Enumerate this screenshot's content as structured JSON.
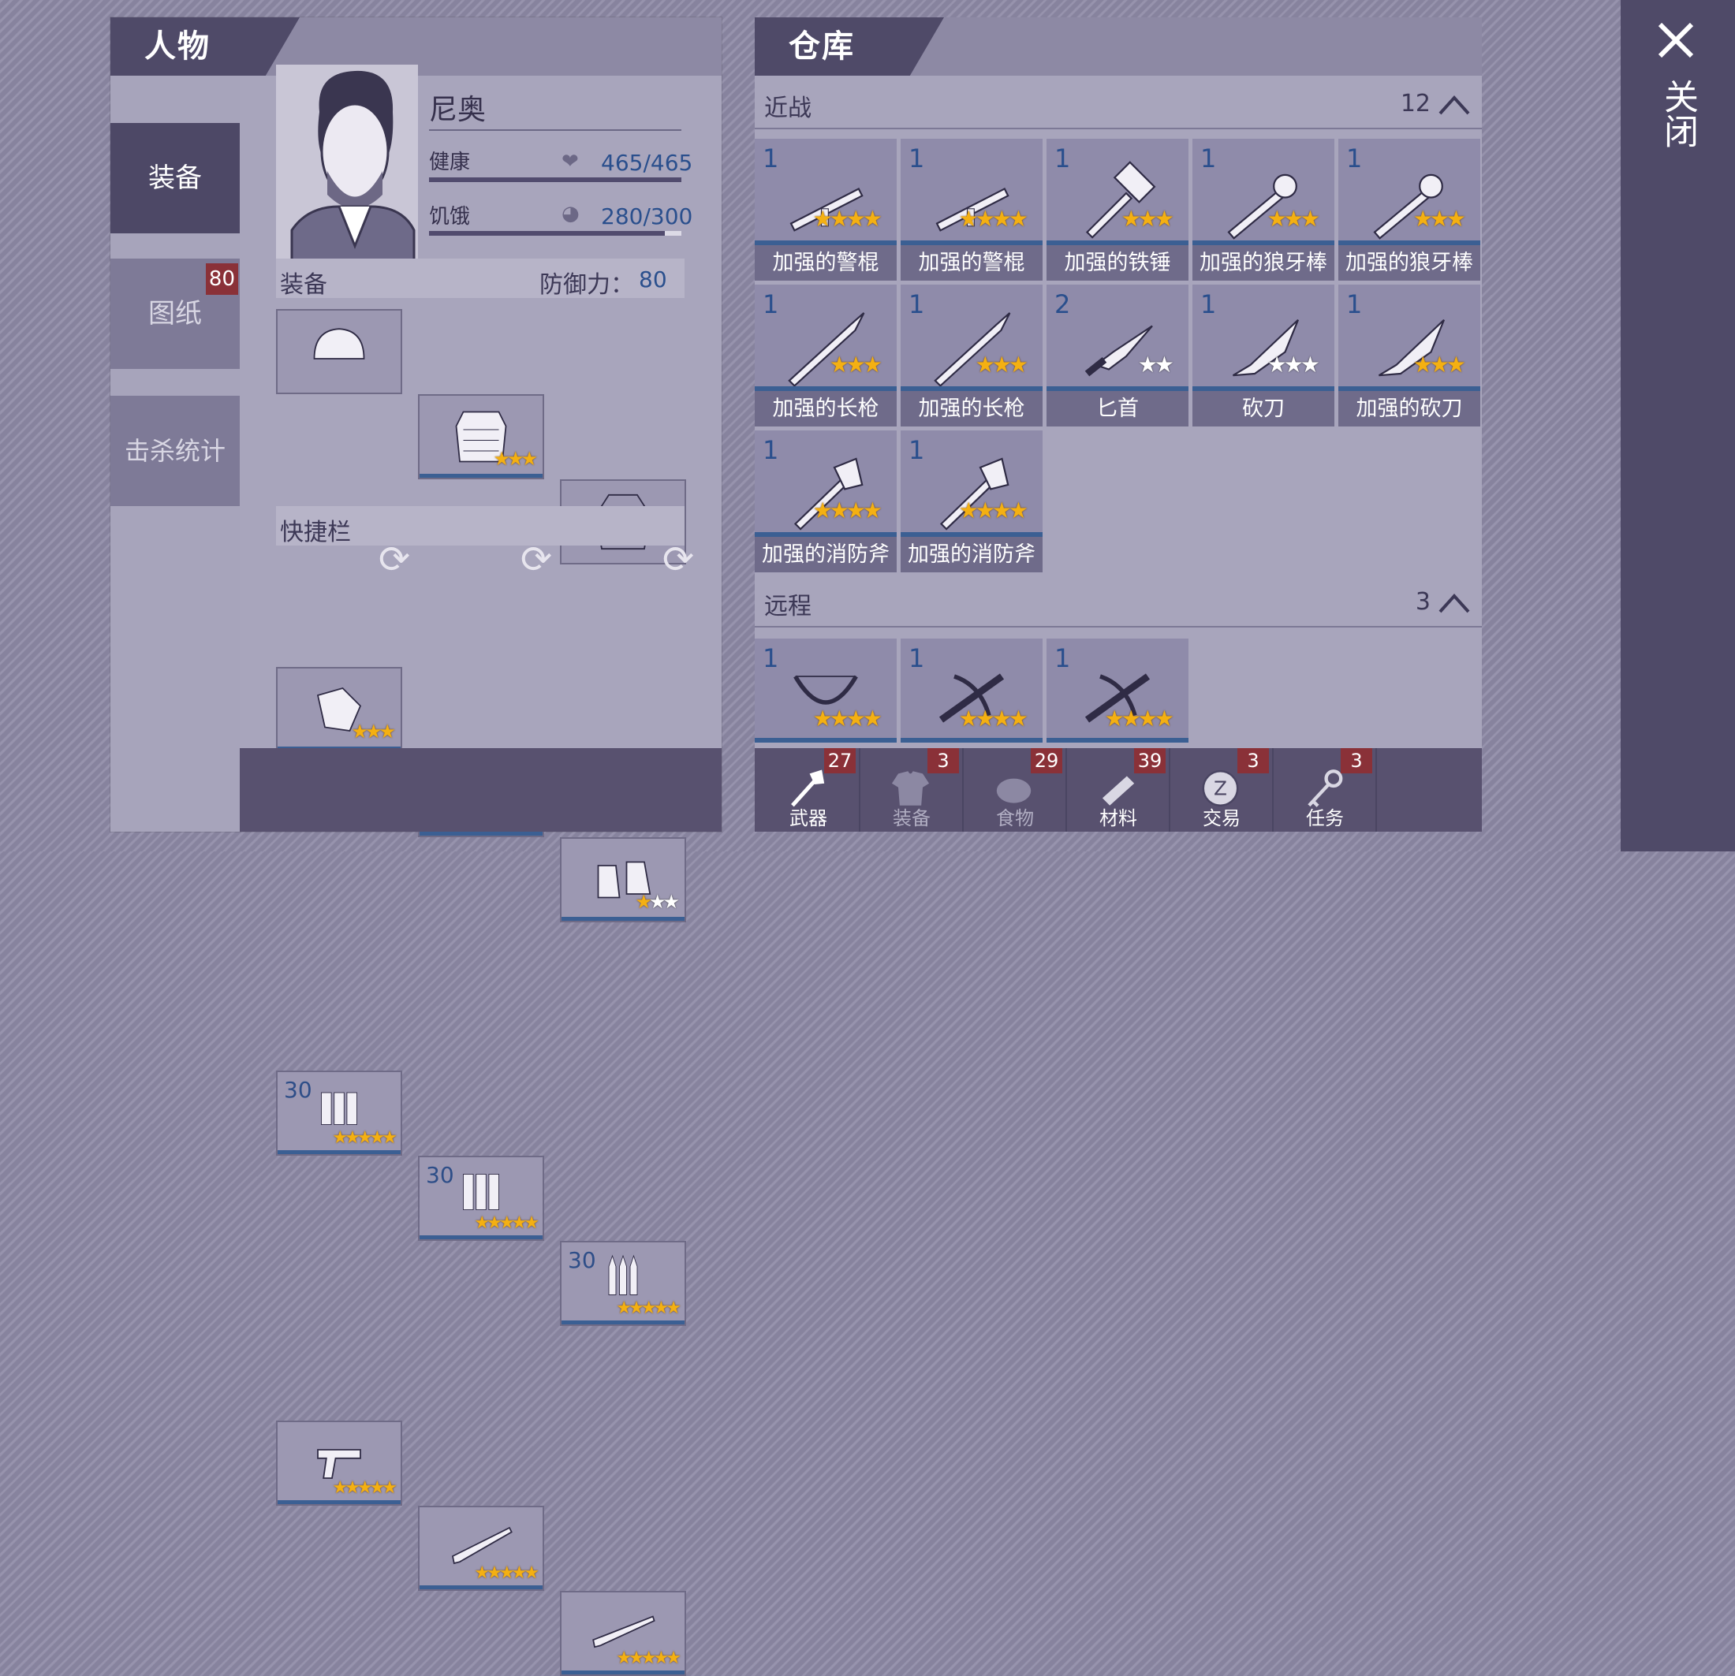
{
  "close": {
    "label": "关闭"
  },
  "left": {
    "title": "人物",
    "side_tabs": [
      {
        "label": "装备"
      },
      {
        "label": "图纸",
        "badge": "80"
      },
      {
        "label": "击杀统计"
      }
    ],
    "character": {
      "name": "尼奥",
      "health_label": "健康",
      "health_value": "465/465",
      "health_fraction": 1.0,
      "hunger_label": "饥饿",
      "hunger_value": "280/300",
      "hunger_fraction": 0.933
    },
    "equipment": {
      "label": "装备",
      "defense_label": "防御力：",
      "defense_value": "80",
      "slots": [
        {
          "icon": "helmet-icon",
          "stars": 0,
          "max_stars": 0
        },
        {
          "icon": "armor-vest-icon",
          "stars": 3,
          "max_stars": 3
        },
        {
          "icon": "jacket-icon",
          "stars": 0,
          "max_stars": 0
        },
        {
          "icon": "gloves-icon",
          "stars": 3,
          "max_stars": 3
        },
        {
          "icon": "pants-icon",
          "stars": 1,
          "max_stars": 3
        },
        {
          "icon": "boots-icon",
          "stars": 1,
          "max_stars": 3
        }
      ]
    },
    "quickbar": {
      "label": "快捷栏",
      "slots": [
        {
          "icon": "pistol-ammo-icon",
          "qty": "30",
          "stars": 5
        },
        {
          "icon": "shotgun-ammo-icon",
          "qty": "30",
          "stars": 5
        },
        {
          "icon": "rifle-ammo-icon",
          "qty": "30",
          "stars": 5
        },
        {
          "icon": "revolver-icon",
          "stars": 5
        },
        {
          "icon": "shotgun-icon",
          "stars": 5
        },
        {
          "icon": "rifle-icon",
          "stars": 5
        }
      ]
    }
  },
  "right": {
    "title": "仓库",
    "melee": {
      "label": "近战",
      "count": "12",
      "items": [
        {
          "name": "加强的警棍",
          "qty": "1",
          "stars": 4,
          "max_stars": 4,
          "icon": "baton-icon"
        },
        {
          "name": "加强的警棍",
          "qty": "1",
          "stars": 4,
          "max_stars": 4,
          "icon": "baton-icon"
        },
        {
          "name": "加强的铁锤",
          "qty": "1",
          "stars": 3,
          "max_stars": 3,
          "icon": "hammer-icon"
        },
        {
          "name": "加强的狼牙棒",
          "qty": "1",
          "stars": 3,
          "max_stars": 3,
          "icon": "mace-icon"
        },
        {
          "name": "加强的狼牙棒",
          "qty": "1",
          "stars": 3,
          "max_stars": 3,
          "icon": "mace-icon"
        },
        {
          "name": "加强的长枪",
          "qty": "1",
          "stars": 3,
          "max_stars": 3,
          "icon": "spear-icon"
        },
        {
          "name": "加强的长枪",
          "qty": "1",
          "stars": 3,
          "max_stars": 3,
          "icon": "spear-icon"
        },
        {
          "name": "匕首",
          "qty": "2",
          "stars": 0,
          "max_stars": 2,
          "icon": "dagger-icon"
        },
        {
          "name": "砍刀",
          "qty": "1",
          "stars": 0,
          "max_stars": 3,
          "icon": "machete-icon"
        },
        {
          "name": "加强的砍刀",
          "qty": "1",
          "stars": 3,
          "max_stars": 3,
          "icon": "machete-icon"
        },
        {
          "name": "加强的消防斧",
          "qty": "1",
          "stars": 4,
          "max_stars": 4,
          "icon": "fire-axe-icon"
        },
        {
          "name": "加强的消防斧",
          "qty": "1",
          "stars": 4,
          "max_stars": 4,
          "icon": "fire-axe-icon"
        }
      ]
    },
    "ranged": {
      "label": "远程",
      "count": "3",
      "items": [
        {
          "qty": "1",
          "stars": 4,
          "icon": "bow-icon"
        },
        {
          "qty": "1",
          "stars": 4,
          "icon": "crossbow-icon"
        },
        {
          "qty": "1",
          "stars": 4,
          "icon": "crossbow-icon"
        }
      ]
    },
    "bottom_tabs": [
      {
        "label": "武器",
        "badge": "27",
        "icon": "axe-icon",
        "active": true
      },
      {
        "label": "装备",
        "badge": "3",
        "icon": "shirt-icon"
      },
      {
        "label": "食物",
        "badge": "29",
        "icon": "food-icon"
      },
      {
        "label": "材料",
        "badge": "39",
        "icon": "log-icon"
      },
      {
        "label": "交易",
        "badge": "3",
        "icon": "coin-icon"
      },
      {
        "label": "任务",
        "badge": "3",
        "icon": "key-icon"
      }
    ]
  }
}
